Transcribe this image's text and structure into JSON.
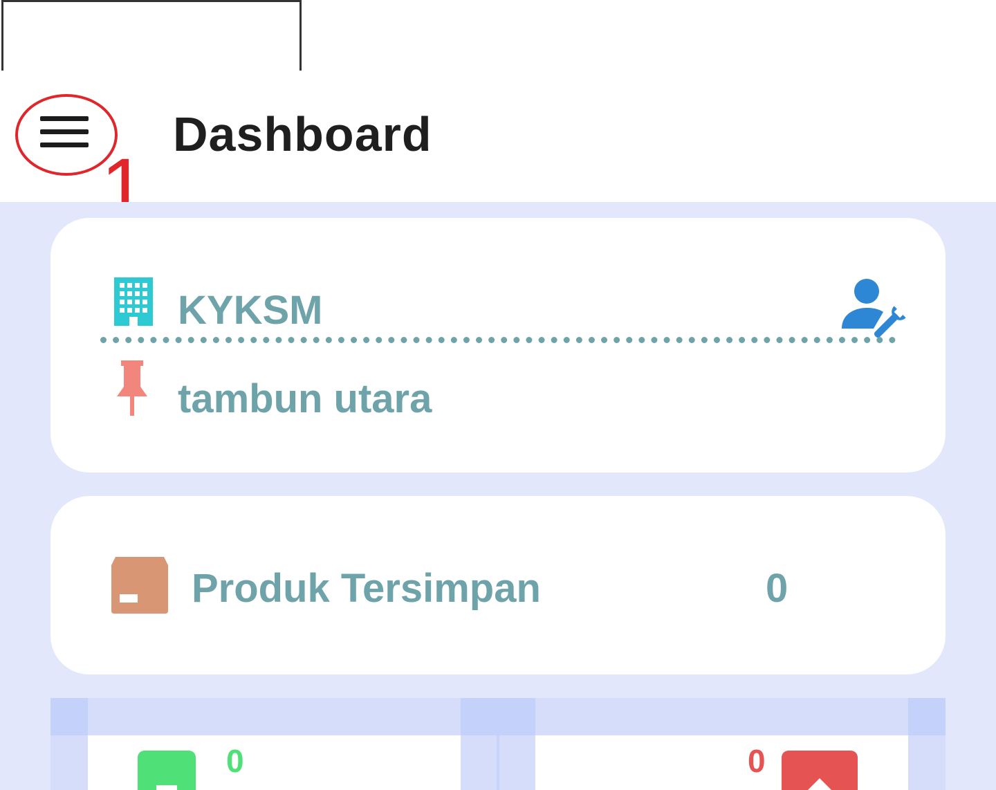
{
  "header": {
    "title": "Dashboard",
    "menu_icon": "hamburger-menu-icon",
    "annotation_label": "1",
    "annotation_color": "#e0262a"
  },
  "store_card": {
    "name": "KYKSM",
    "location": "tambun utara",
    "building_icon": "building-icon",
    "pin_icon": "pushpin-icon",
    "admin_icon": "user-wrench-icon",
    "text_color": "#6ea3aa"
  },
  "stock_card": {
    "label": "Produk Tersimpan",
    "value": "0",
    "icon": "box-icon"
  },
  "summary": {
    "in_value": "0",
    "in_icon": "plus-square-icon",
    "in_color": "#4fe078",
    "out_value": "0",
    "out_icon": "arrow-up-icon",
    "out_color": "#e55353"
  },
  "colors": {
    "background": "#e2e7fb",
    "card": "#ffffff"
  }
}
